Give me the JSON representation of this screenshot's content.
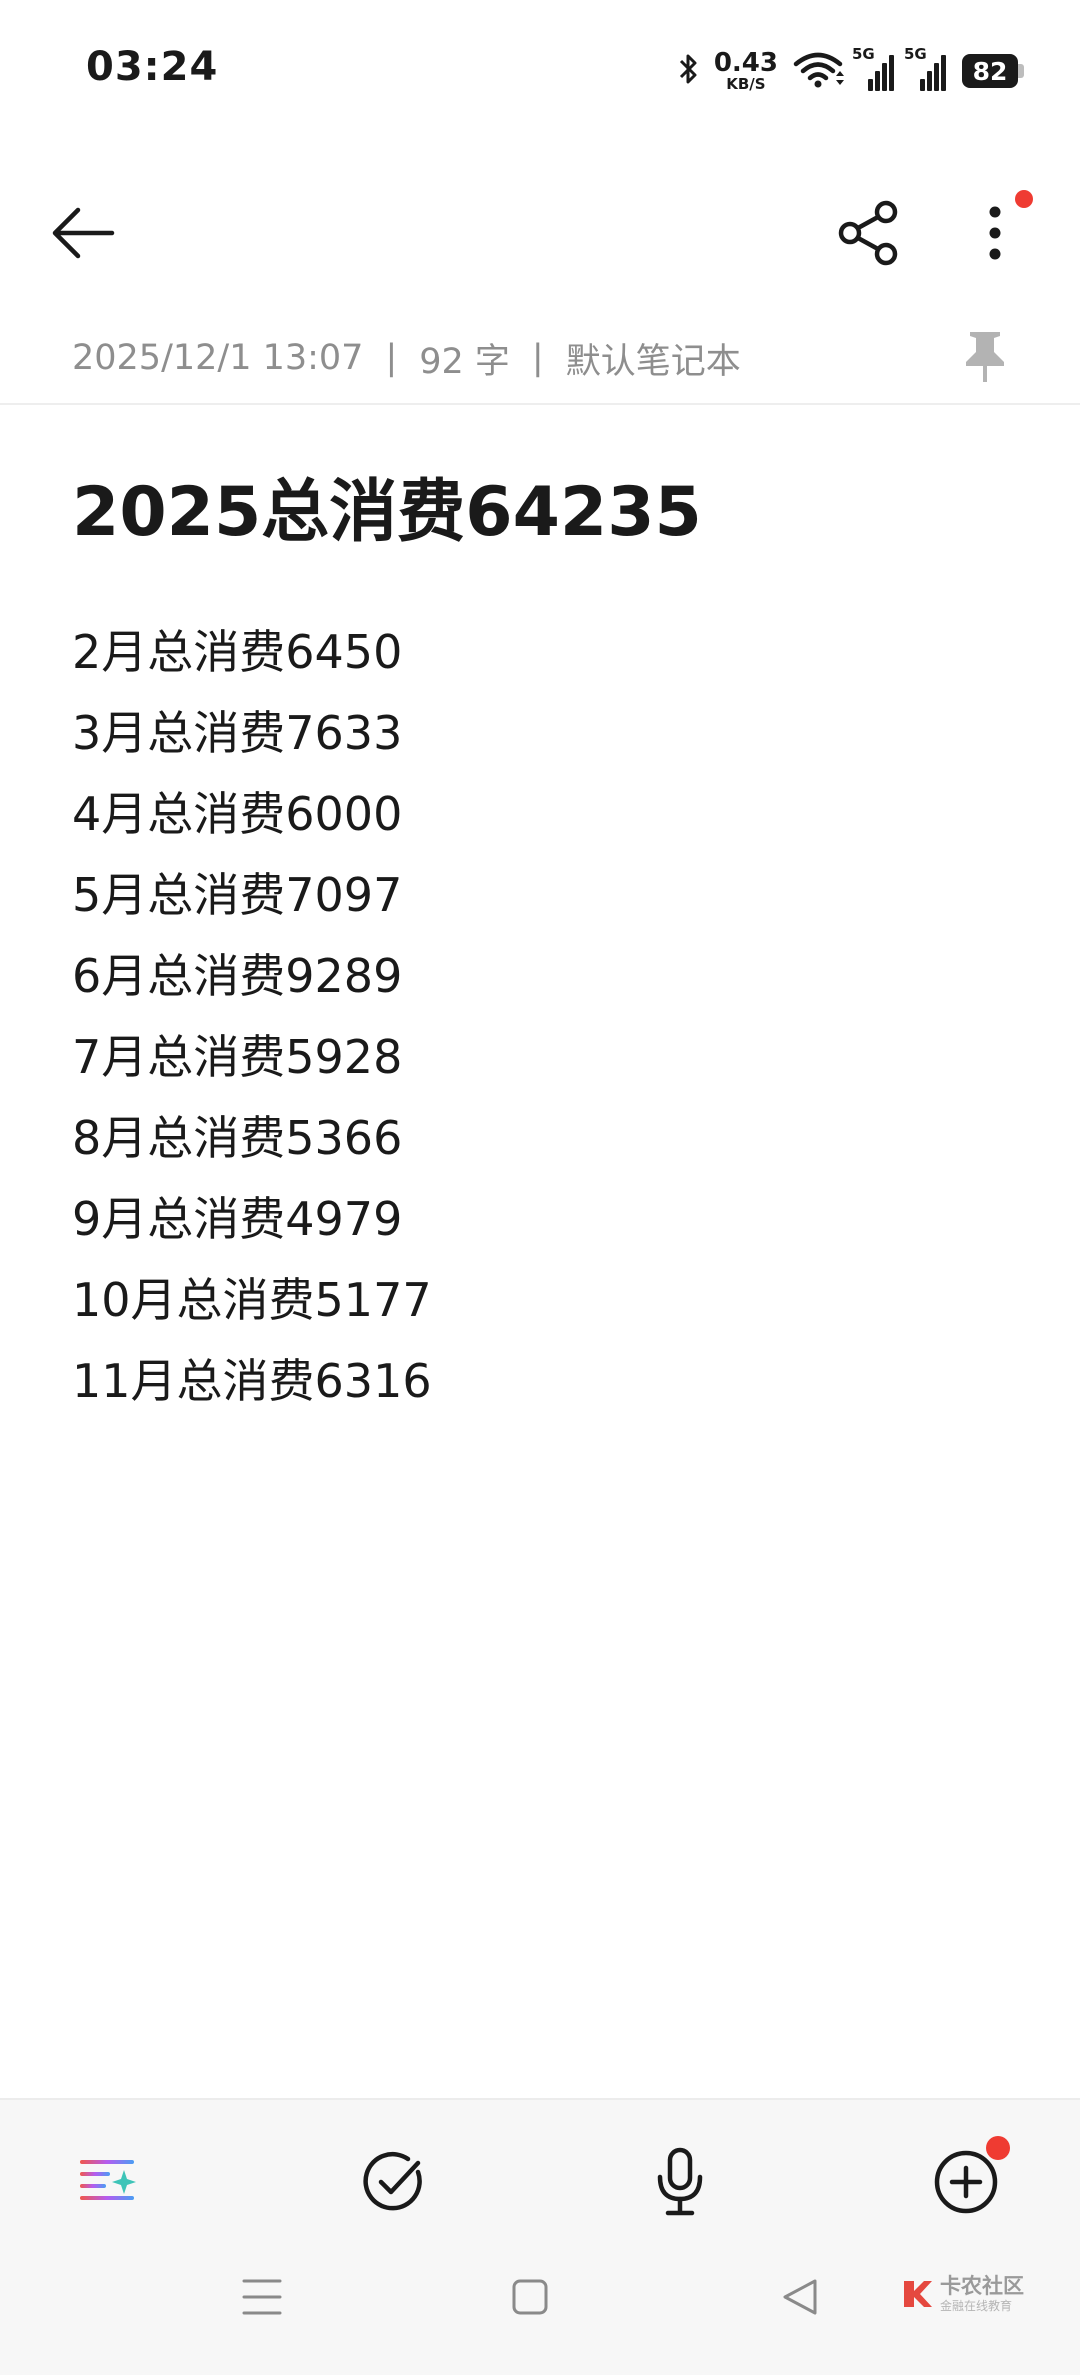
{
  "status_bar": {
    "time": "03:24",
    "net_speed_value": "0.43",
    "net_speed_unit": "KB/S",
    "sim1_label": "5G",
    "sim2_label": "5G",
    "battery_level": "82",
    "icons": [
      "bluetooth-icon",
      "wifi-icon",
      "signal-icon",
      "battery-icon"
    ]
  },
  "toolbar": {
    "icons": [
      "back-arrow-icon",
      "share-icon",
      "more-vertical-icon"
    ],
    "notification_dot_color": "#ef3b32"
  },
  "meta": {
    "datetime": "2025/12/1 13:07",
    "separator": "|",
    "char_count": "92 字",
    "notebook": "默认笔记本",
    "pin_icon": "pin-icon"
  },
  "note": {
    "title": "2025总消费64235",
    "lines": [
      "2月总消费6450",
      "3月总消费7633",
      "4月总消费6000",
      "5月总消费7097",
      "6月总消费9289",
      "7月总消费5928",
      "8月总消费5366",
      "9月总消费4979",
      "10月总消费5177",
      "11月总消费6316"
    ]
  },
  "bottom_bar": {
    "icons": [
      "ai-format-icon",
      "checklist-icon",
      "microphone-icon",
      "add-circle-icon"
    ]
  },
  "system_nav": {
    "icons": [
      "recents-icon",
      "home-icon",
      "back-triangle-icon"
    ]
  },
  "watermark": {
    "main": "卡农社区",
    "sub": "金融在线教育",
    "accent_color": "#e5483f"
  }
}
